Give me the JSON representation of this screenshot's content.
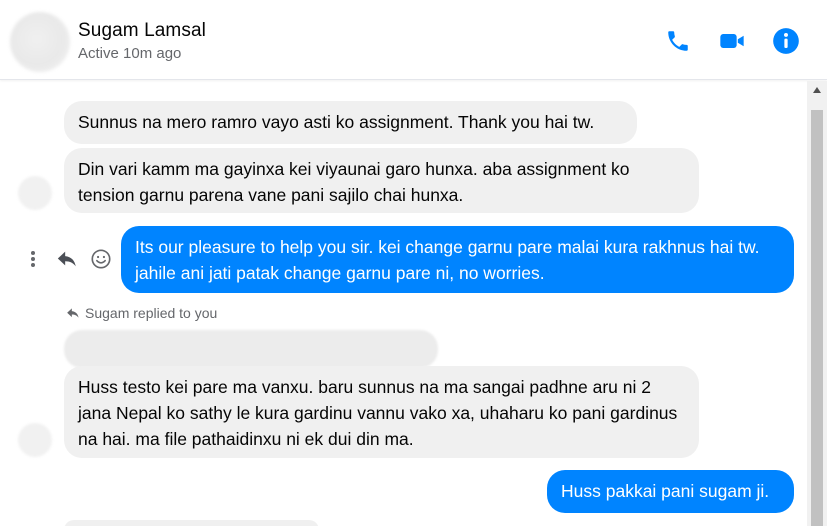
{
  "header": {
    "contact_name": "Sugam Lamsal",
    "status": "Active 10m ago",
    "accent_color": "#0084ff",
    "icons": [
      "phone-icon",
      "video-camera-icon",
      "info-icon"
    ]
  },
  "messages": [
    {
      "from": "contact",
      "text": "Sunnus na mero ramro vayo asti ko assignment. Thank you hai tw."
    },
    {
      "from": "contact",
      "text": "Din vari kamm ma gayinxa kei viyaunai garo hunxa. aba assignment ko tension garnu parena vane pani sajilo chai hunxa."
    },
    {
      "from": "me",
      "text": "Its our pleasure to help you sir. kei change garnu pare malai kura rakhnus hai tw. jahile ani jati patak change garnu pare ni, no worries."
    },
    {
      "from": "contact",
      "text": "Huss testo kei pare ma vanxu. baru sunnus na ma sangai padhne aru ni 2 jana Nepal ko sathy le kura gardinu vannu vako xa, uhaharu ko pani gardinus na hai. ma file pathaidinxu ni ek dui din ma."
    },
    {
      "from": "me",
      "text": "Huss pakkai pani sugam ji."
    }
  ],
  "reply_note": "Sugam replied to you",
  "message_actions": [
    "more-options-icon",
    "reply-icon",
    "emoji-reaction-icon"
  ]
}
